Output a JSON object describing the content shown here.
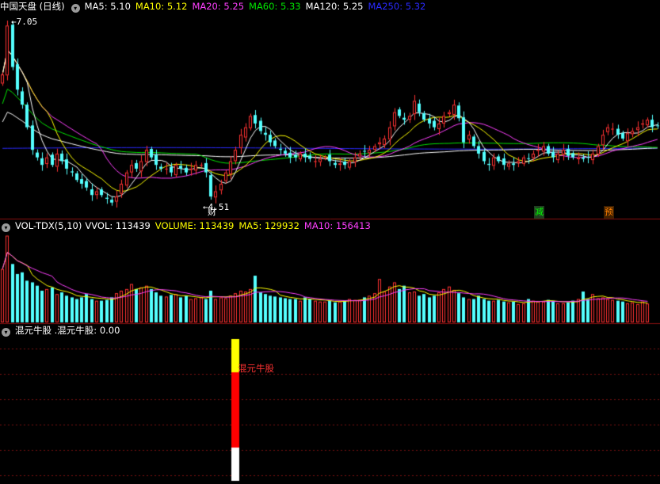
{
  "colors": {
    "up": "#ff3232",
    "down": "#54ffff",
    "ma5": "#ffffff",
    "ma10": "#ffff00",
    "ma20": "#ff40ff",
    "ma60": "#00e600",
    "ma120": "#ffffff",
    "ma250": "#2a2aff",
    "grid": "#7a1010",
    "signal_white": "#ffffff",
    "signal_red": "#ff0000",
    "signal_yellow": "#ffff00"
  },
  "panel_price": {
    "title": "中国天盘 (日线)",
    "legend": [
      {
        "label": "MA5: 5.10",
        "color": "#ffffff"
      },
      {
        "label": "MA10: 5.12",
        "color": "#ffff00"
      },
      {
        "label": "MA20: 5.25",
        "color": "#ff40ff"
      },
      {
        "label": "MA60: 5.33",
        "color": "#00e600"
      },
      {
        "label": "MA120: 5.25",
        "color": "#ffffff"
      },
      {
        "label": "MA250: 5.32",
        "color": "#2a2aff"
      }
    ],
    "high_label": "7.05",
    "low_label": "4.51",
    "markers": [
      {
        "text": "财",
        "bar": 42,
        "color": "#ffffff",
        "bg": ""
      },
      {
        "text": "减",
        "bar": 108,
        "color": "#00ff00",
        "bg": "#204020"
      },
      {
        "text": "预",
        "bar": 122,
        "color": "#ff8000",
        "bg": "#402000"
      }
    ]
  },
  "panel_volume": {
    "title": "VOL-TDX(5,10)",
    "legend": [
      {
        "label": "VVOL: 113439",
        "color": "#ffffff"
      },
      {
        "label": "VOLUME: 113439",
        "color": "#ffff00"
      },
      {
        "label": "MA5: 129932",
        "color": "#ffff00"
      },
      {
        "label": "MA10: 156413",
        "color": "#ff40ff"
      }
    ]
  },
  "panel_indicator": {
    "title": "混元牛股 .混元牛股: 0.00",
    "signal_label": "混元牛股",
    "signal_bar": 47
  },
  "chart_data": {
    "type": "candlestick",
    "price_range": [
      4.45,
      7.1
    ],
    "closes": [
      6.3,
      6.95,
      6.4,
      6.1,
      5.9,
      5.6,
      5.3,
      5.2,
      5.1,
      5.2,
      5.1,
      5.25,
      5.15,
      5.05,
      5.0,
      4.9,
      4.85,
      4.8,
      4.7,
      4.75,
      4.7,
      4.65,
      4.6,
      4.68,
      4.85,
      5.0,
      5.1,
      5.05,
      5.15,
      5.3,
      5.2,
      5.1,
      5.05,
      5.05,
      5.0,
      5.1,
      5.05,
      5.0,
      5.05,
      5.1,
      5.1,
      5.0,
      4.68,
      4.75,
      4.85,
      5.0,
      5.15,
      5.3,
      5.5,
      5.6,
      5.75,
      5.65,
      5.55,
      5.5,
      5.4,
      5.35,
      5.3,
      5.25,
      5.2,
      5.2,
      5.25,
      5.2,
      5.18,
      5.15,
      5.18,
      5.2,
      5.15,
      5.1,
      5.12,
      5.1,
      5.15,
      5.2,
      5.25,
      5.28,
      5.3,
      5.35,
      5.4,
      5.45,
      5.6,
      5.8,
      5.75,
      5.7,
      5.75,
      5.95,
      5.8,
      5.7,
      5.65,
      5.6,
      5.65,
      5.75,
      5.8,
      5.9,
      5.72,
      5.4,
      5.5,
      5.35,
      5.25,
      5.15,
      5.1,
      5.2,
      5.15,
      5.1,
      5.12,
      5.1,
      5.15,
      5.2,
      5.18,
      5.25,
      5.3,
      5.35,
      5.25,
      5.2,
      5.25,
      5.3,
      5.22,
      5.2,
      5.2,
      5.18,
      5.2,
      5.25,
      5.35,
      5.5,
      5.6,
      5.58,
      5.5,
      5.45,
      5.52,
      5.55,
      5.6,
      5.65,
      5.7,
      5.6,
      5.62
    ],
    "volumes": [
      320,
      520,
      350,
      290,
      300,
      250,
      240,
      220,
      190,
      200,
      210,
      170,
      180,
      160,
      150,
      140,
      150,
      170,
      140,
      130,
      130,
      135,
      150,
      175,
      190,
      200,
      230,
      200,
      210,
      220,
      200,
      180,
      160,
      155,
      165,
      170,
      150,
      160,
      140,
      145,
      150,
      140,
      190,
      140,
      150,
      145,
      160,
      175,
      190,
      185,
      200,
      280,
      180,
      170,
      160,
      155,
      150,
      145,
      140,
      140,
      130,
      150,
      140,
      130,
      125,
      125,
      130,
      120,
      125,
      130,
      140,
      135,
      135,
      150,
      160,
      175,
      260,
      185,
      215,
      240,
      200,
      220,
      180,
      185,
      160,
      170,
      150,
      160,
      180,
      200,
      215,
      195,
      175,
      150,
      140,
      140,
      160,
      140,
      130,
      130,
      135,
      125,
      120,
      125,
      110,
      115,
      140,
      130,
      125,
      125,
      135,
      130,
      115,
      115,
      120,
      130,
      140,
      185,
      140,
      170,
      145,
      150,
      140,
      135,
      130,
      125,
      115,
      120,
      110,
      125,
      113
    ],
    "ma_last": {
      "ma5": 5.1,
      "ma10": 5.12,
      "ma20": 5.25,
      "ma60": 5.33,
      "ma120": 5.25,
      "ma250": 5.32
    },
    "indicator_signal": {
      "bar": 47,
      "value": 1
    },
    "y_extremes": {
      "high": 7.05,
      "low": 4.51
    }
  }
}
